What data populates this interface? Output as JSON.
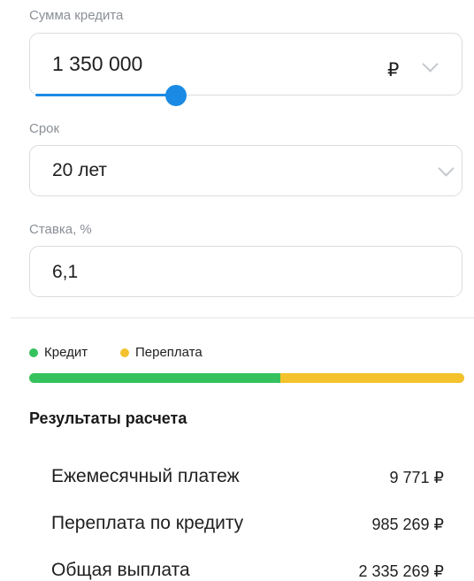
{
  "form": {
    "amount_label": "Сумма кредита",
    "amount_value": "1 350 000",
    "currency": "₽",
    "amount_slider_fraction": 0.33,
    "term_label": "Срок",
    "term_value": "20 лет",
    "rate_label": "Ставка, %",
    "rate_value": "6,1"
  },
  "legend": {
    "credit": "Кредит",
    "overpay": "Переплата",
    "credit_color": "#35c25e",
    "overpay_color": "#f3c22c"
  },
  "breakdown": {
    "credit_amount": 1350000,
    "overpay_amount": 985269
  },
  "results": {
    "title": "Результаты расчета",
    "rows": [
      {
        "label": "Ежемесячный платеж",
        "value": "9 771 ₽"
      },
      {
        "label": "Переплата по кредиту",
        "value": "985 269 ₽"
      },
      {
        "label": "Общая выплата",
        "value": "2 335 269 ₽"
      }
    ]
  },
  "colors": {
    "accent": "#1a8ae5"
  }
}
